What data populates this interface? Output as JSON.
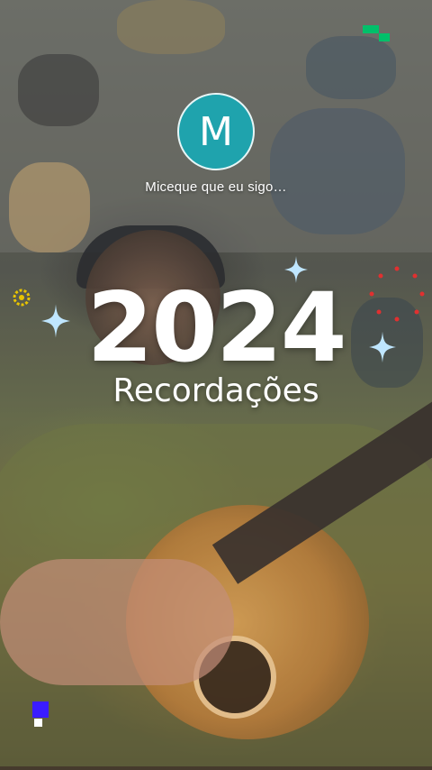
{
  "profile": {
    "initial": "M",
    "username": "Miceque que eu sigo…",
    "avatar_color": "#1fa3ad"
  },
  "recap": {
    "year": "2024",
    "subtitle": "Recordações"
  },
  "decorations": {
    "sparkle_color": "#bfe6ff",
    "ring_color": "#e8c400",
    "dots_color": "#e03030",
    "corner_top_color": "#00c06a",
    "corner_bottom_color": "#3a1cff"
  }
}
